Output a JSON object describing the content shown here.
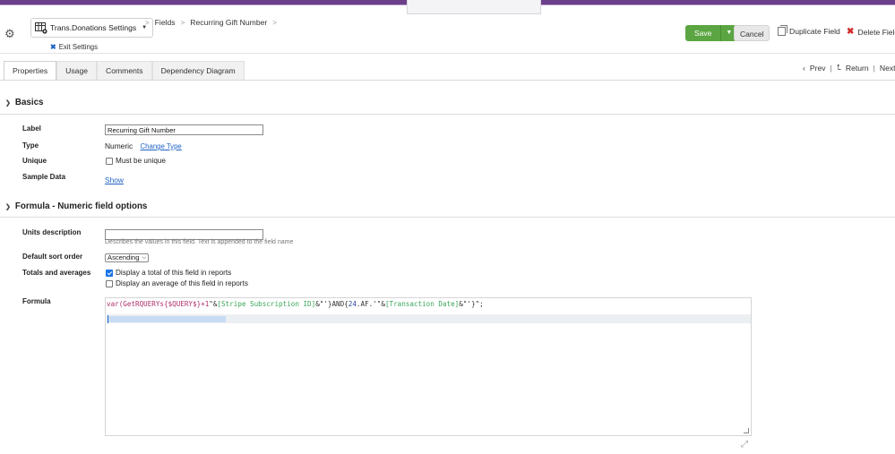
{
  "header": {
    "table_name": "Trans.Donations Settings",
    "breadcrumb": [
      "Fields",
      "Recurring Gift Number"
    ],
    "exit_label": "Exit Settings",
    "save_label": "Save",
    "cancel_label": "Cancel",
    "duplicate_label": "Duplicate Field",
    "delete_label": "Delete Field"
  },
  "tabs": [
    "Properties",
    "Usage",
    "Comments",
    "Dependency Diagram"
  ],
  "nav": {
    "prev": "Prev",
    "return": "Return",
    "next": "Next"
  },
  "basics": {
    "title": "Basics",
    "label_label": "Label",
    "label_value": "Recurring Gift Number",
    "type_label": "Type",
    "type_value": "Numeric",
    "change_type": "Change Type",
    "unique_label": "Unique",
    "unique_option": "Must be unique",
    "sample_label": "Sample Data",
    "sample_link": "Show"
  },
  "formula_section": {
    "title": "Formula - Numeric field options",
    "units_label": "Units description",
    "units_value": "",
    "units_hint": "Describes the values in this field. Text is appended to the field name",
    "sort_label": "Default sort order",
    "sort_value": "Ascending",
    "totals_label": "Totals and averages",
    "total_option": "Display a total of this field in reports",
    "total_checked": true,
    "avg_option": "Display an average of this field in reports",
    "avg_checked": false,
    "formula_label": "Formula",
    "formula_parts": {
      "p1": "var(GetRQUERYs{$QUERY$}+1",
      "p2": "\"&",
      "p3": "[Stripe Subscription ID]",
      "p4": "&\"'}AND{",
      "p5": "24",
      "p6": ".AF.'\"&",
      "p7": "[Transaction Date]",
      "p8": "&\"'}\";"
    }
  },
  "colors": {
    "accent": "#5ba642",
    "link": "#1e63c4",
    "topbar": "#6b3f8a"
  }
}
